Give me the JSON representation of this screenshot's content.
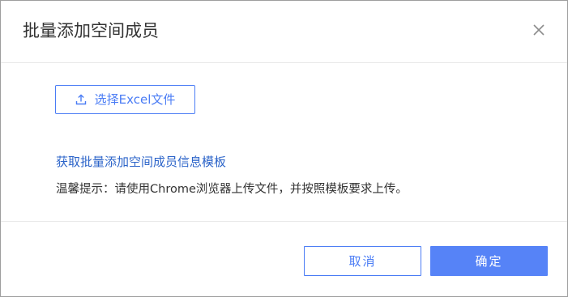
{
  "dialog": {
    "title": "批量添加空间成员",
    "close_icon": "close-icon"
  },
  "upload": {
    "icon": "upload-icon",
    "label": "选择Excel文件"
  },
  "template_link": "获取批量添加空间成员信息模板",
  "tip": "温馨提示：请使用Chrome浏览器上传文件，并按照模板要求上传。",
  "footer": {
    "cancel_label": "取消",
    "ok_label": "确定"
  },
  "colors": {
    "accent": "#4a7cf5",
    "primary_button": "#5683f7",
    "link": "#2c64c9"
  }
}
